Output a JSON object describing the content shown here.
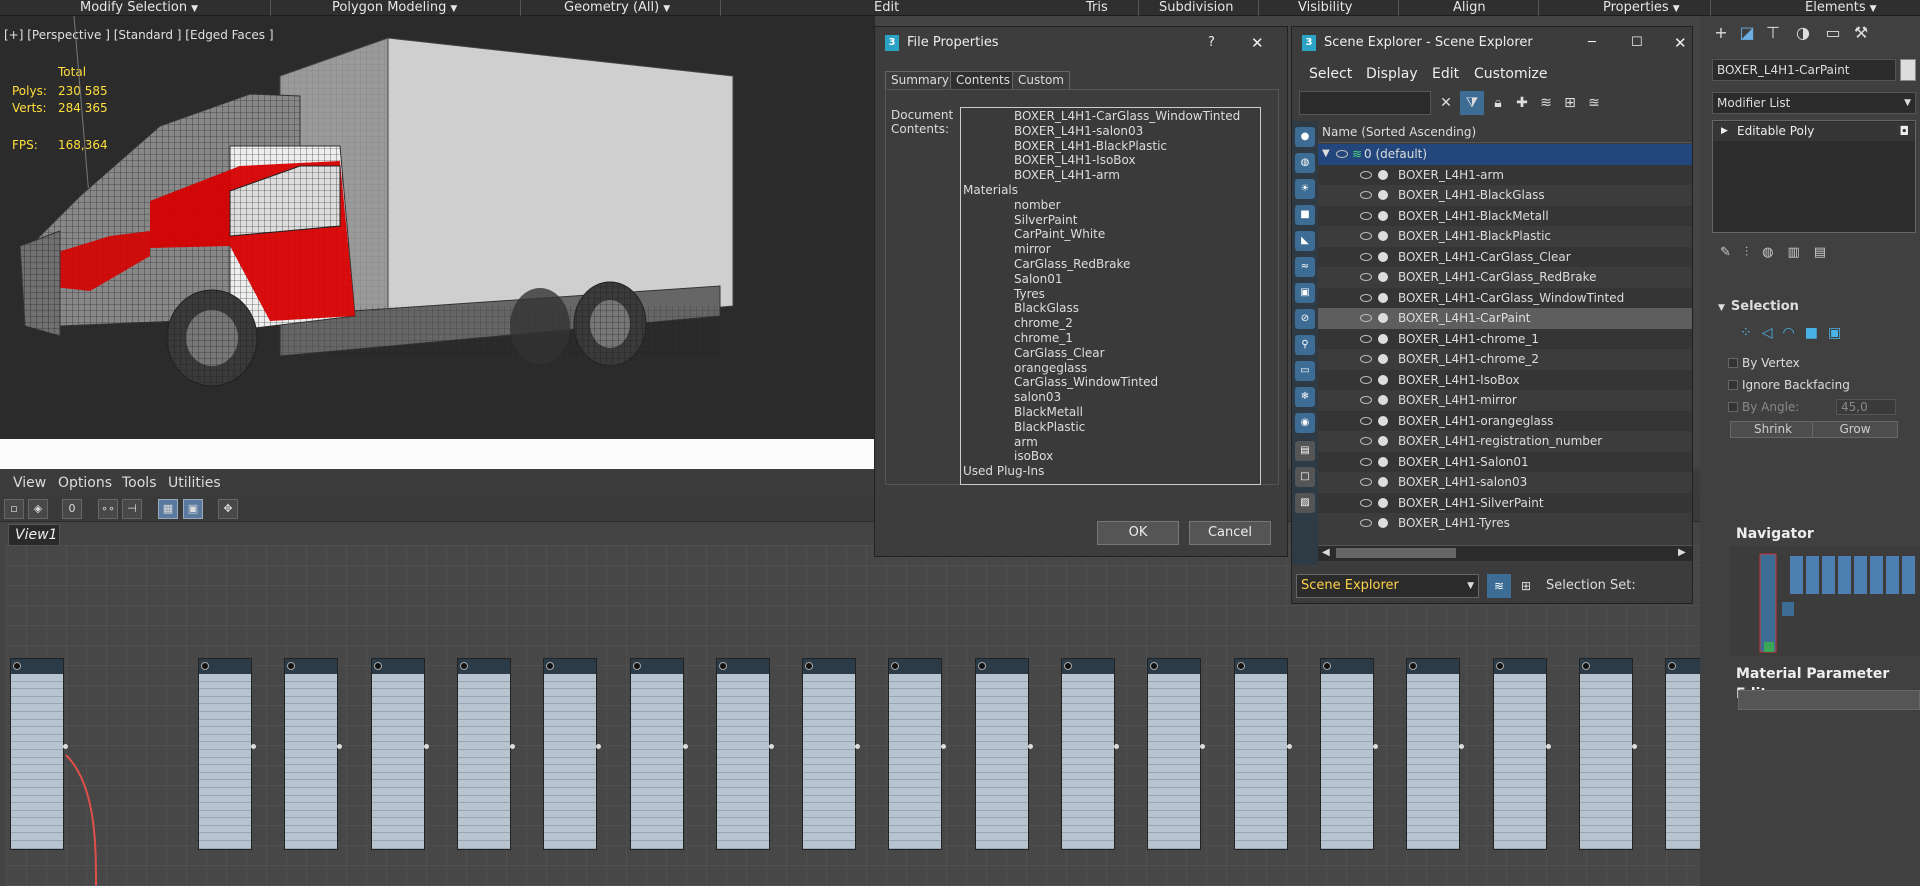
{
  "menubar": {
    "items": [
      "Modify Selection",
      "Polygon Modeling",
      "Geometry (All)",
      "Edit",
      "Tris",
      "Subdivision",
      "Visibility",
      "Align",
      "Properties",
      "Elements"
    ]
  },
  "viewport": {
    "label": "[+] [Perspective ] [Standard ] [Edged Faces ]",
    "total_label": "Total",
    "polys_label": "Polys:",
    "polys_value": "230 585",
    "verts_label": "Verts:",
    "verts_value": "284 365",
    "fps_label": "FPS:",
    "fps_value": "168,364"
  },
  "slate": {
    "menu": [
      "View",
      "Options",
      "Tools",
      "Utilities"
    ],
    "view_tab": "View1",
    "node_count": 19
  },
  "command_panel": {
    "object_name": "BOXER_L4H1-CarPaint",
    "modifier_list": "Modifier List",
    "modifier_item": "Editable Poly",
    "selection_title": "Selection",
    "by_vertex": "By Vertex",
    "ignore_backfacing": "Ignore Backfacing",
    "by_angle": "By Angle:",
    "angle_value": "45,0",
    "shrink": "Shrink",
    "grow": "Grow",
    "navigator": "Navigator",
    "mpe": "Material Parameter Editor"
  },
  "file_properties": {
    "title": "File Properties",
    "help": "?",
    "close": "✕",
    "tabs": [
      "Summary",
      "Contents",
      "Custom"
    ],
    "doc_label_line1": "Document",
    "doc_label_line2": "Contents:",
    "lines": [
      {
        "indent": 1,
        "text": "BOXER_L4H1-CarGlass_WindowTinted"
      },
      {
        "indent": 1,
        "text": "BOXER_L4H1-salon03"
      },
      {
        "indent": 1,
        "text": "BOXER_L4H1-BlackPlastic"
      },
      {
        "indent": 1,
        "text": "BOXER_L4H1-IsoBox"
      },
      {
        "indent": 1,
        "text": "BOXER_L4H1-arm"
      },
      {
        "indent": 0,
        "text": "Materials"
      },
      {
        "indent": 1,
        "text": "nomber"
      },
      {
        "indent": 1,
        "text": "SilverPaint"
      },
      {
        "indent": 1,
        "text": "CarPaint_White"
      },
      {
        "indent": 1,
        "text": "mirror"
      },
      {
        "indent": 1,
        "text": "CarGlass_RedBrake"
      },
      {
        "indent": 1,
        "text": "Salon01"
      },
      {
        "indent": 1,
        "text": "Tyres"
      },
      {
        "indent": 1,
        "text": "BlackGlass"
      },
      {
        "indent": 1,
        "text": "chrome_2"
      },
      {
        "indent": 1,
        "text": "chrome_1"
      },
      {
        "indent": 1,
        "text": "CarGlass_Clear"
      },
      {
        "indent": 1,
        "text": "orangeglass"
      },
      {
        "indent": 1,
        "text": "CarGlass_WindowTinted"
      },
      {
        "indent": 1,
        "text": "salon03"
      },
      {
        "indent": 1,
        "text": "BlackMetall"
      },
      {
        "indent": 1,
        "text": "BlackPlastic"
      },
      {
        "indent": 1,
        "text": "arm"
      },
      {
        "indent": 1,
        "text": "isoBox"
      },
      {
        "indent": 0,
        "text": "Used Plug-Ins"
      }
    ],
    "ok": "OK",
    "cancel": "Cancel"
  },
  "scene_explorer": {
    "title": "Scene Explorer - Scene Explorer",
    "menu": [
      "Select",
      "Display",
      "Edit",
      "Customize"
    ],
    "header": "Name (Sorted Ascending)",
    "layer": "0 (default)",
    "objects": [
      "BOXER_L4H1-arm",
      "BOXER_L4H1-BlackGlass",
      "BOXER_L4H1-BlackMetall",
      "BOXER_L4H1-BlackPlastic",
      "BOXER_L4H1-CarGlass_Clear",
      "BOXER_L4H1-CarGlass_RedBrake",
      "BOXER_L4H1-CarGlass_WindowTinted",
      "BOXER_L4H1-CarPaint",
      "BOXER_L4H1-chrome_1",
      "BOXER_L4H1-chrome_2",
      "BOXER_L4H1-IsoBox",
      "BOXER_L4H1-mirror",
      "BOXER_L4H1-orangeglass",
      "BOXER_L4H1-registration_number",
      "BOXER_L4H1-Salon01",
      "BOXER_L4H1-salon03",
      "BOXER_L4H1-SilverPaint",
      "BOXER_L4H1-Tyres"
    ],
    "selected_index": 7,
    "combo": "Scene Explorer",
    "selection_set": "Selection Set:"
  },
  "colors": {
    "accent": "#3d6d94",
    "stat_yellow": "#ffdf3e",
    "car_red": "#d60000"
  }
}
